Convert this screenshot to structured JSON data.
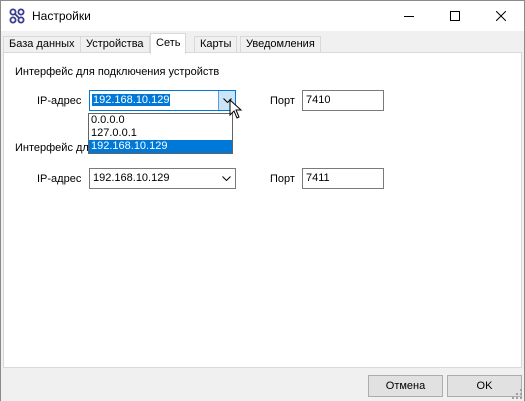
{
  "window": {
    "title": "Настройки",
    "colors": {
      "accent": "#0078d7",
      "panel": "#ffffff",
      "chrome": "#f0f0f0"
    }
  },
  "tabs": [
    {
      "label": "База данных"
    },
    {
      "label": "Устройства"
    },
    {
      "label": "Сеть",
      "active": true
    },
    {
      "label": "Карты"
    },
    {
      "label": "Уведомления"
    }
  ],
  "devices_group": {
    "title": "Интерфейс для подключения устройств",
    "ip_label": "IP-адрес",
    "ip_value": "192.168.10.129",
    "port_label": "Порт",
    "port_value": "7410",
    "dropdown_options": [
      "0.0.0.0",
      "127.0.0.1",
      "192.168.10.129"
    ],
    "dropdown_selected": "192.168.10.129"
  },
  "second_group": {
    "title": "Интерфейс для",
    "ip_label": "IP-адрес",
    "ip_value": "192.168.10.129",
    "port_label": "Порт",
    "port_value": "7411"
  },
  "footer": {
    "cancel_label": "Отмена",
    "ok_label": "OK"
  }
}
